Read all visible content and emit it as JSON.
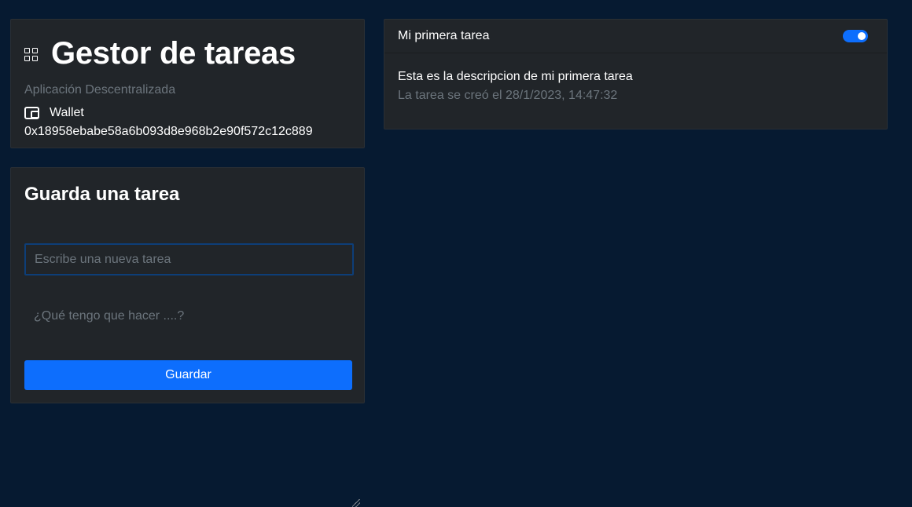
{
  "header": {
    "title": "Gestor de tareas",
    "subtitle": "Aplicación Descentralizada",
    "wallet_label": "Wallet",
    "wallet_address": "0x18958ebabe58a6b093d8e968b2e90f572c12c889"
  },
  "form": {
    "title": "Guarda una tarea",
    "title_placeholder": "Escribe una nueva tarea",
    "title_value": "",
    "description_placeholder": "¿Qué tengo que hacer ....?",
    "description_value": "",
    "save_label": "Guardar"
  },
  "tasks": [
    {
      "title": "Mi primera tarea",
      "done": true,
      "description": "Esta es la descripcion de mi primera tarea",
      "created": "La tarea se creó el 28/1/2023, 14:47:32"
    }
  ],
  "colors": {
    "background": "#061a31",
    "card": "#212529",
    "accent": "#0d6efd",
    "muted_text": "#6c757d"
  },
  "icons": {
    "app": "grid-icon",
    "wallet": "wallet-icon",
    "toggle": "toggle-switch"
  }
}
